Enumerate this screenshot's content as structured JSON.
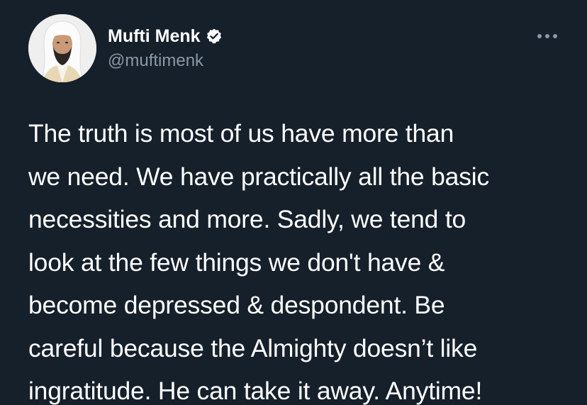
{
  "author": {
    "display_name": "Mufti Menk",
    "handle": "@muftimenk",
    "verified": true,
    "avatar_icon": "profile-photo"
  },
  "more_icon": "ellipsis-icon",
  "tweet": {
    "lines": [
      "The truth is most of us have more than",
      "we need. We have practically all the basic",
      "necessities and more. Sadly, we tend to",
      "look at the few things we don't have &",
      "become depressed & despondent. Be",
      "careful because the Almighty doesn’t like",
      "ingratitude. He can take it away. Anytime!"
    ]
  },
  "colors": {
    "background": "#15202b",
    "text": "#ffffff",
    "secondary_text": "#8b98a5"
  }
}
